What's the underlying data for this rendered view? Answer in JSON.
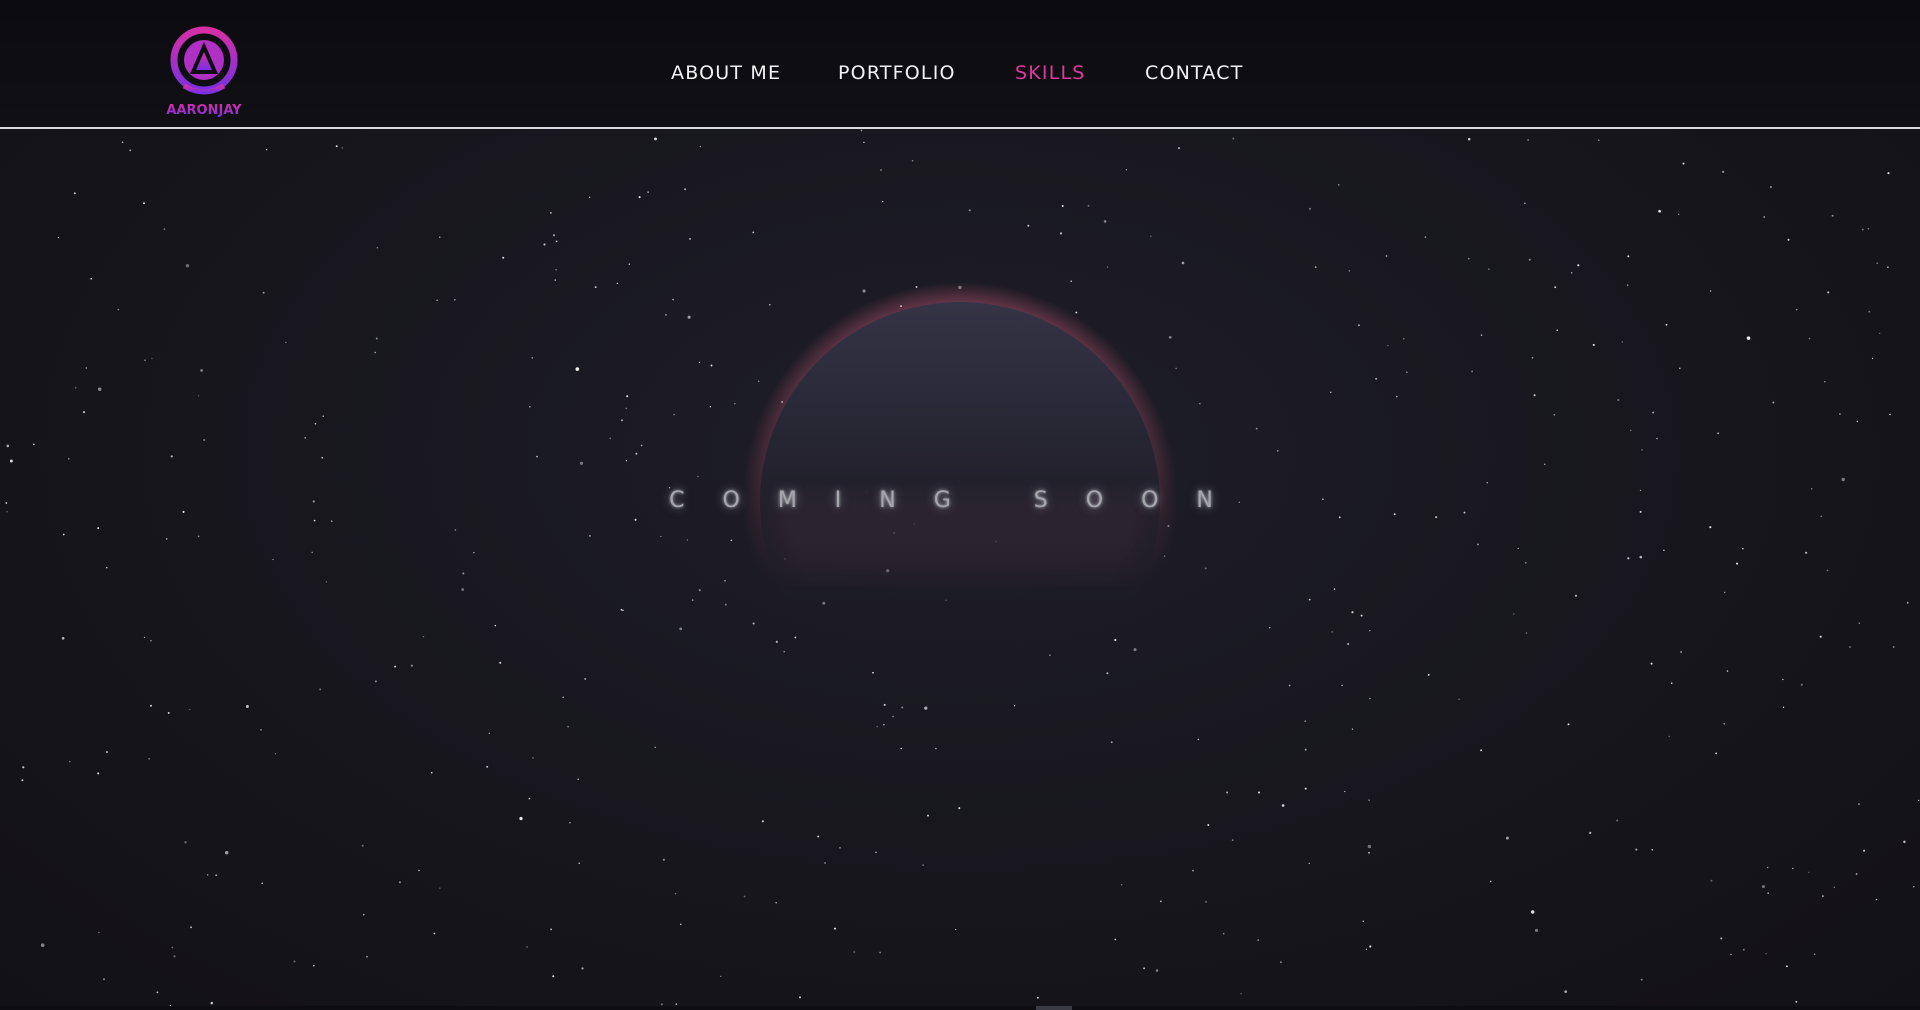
{
  "header": {
    "logo_text": "AARONJAY",
    "nav": [
      {
        "label": "ABOUT ME",
        "active": false
      },
      {
        "label": "PORTFOLIO",
        "active": false
      },
      {
        "label": "SKILLS",
        "active": true
      },
      {
        "label": "CONTACT",
        "active": false
      }
    ]
  },
  "hero": {
    "headline": "COMING SOON"
  },
  "colors": {
    "accent": "#e0369f",
    "logo_gradient_start": "#d62fa6",
    "logo_gradient_end": "#7a2fe0",
    "planet_glow": "#ff7a9c",
    "background": "#17161d"
  },
  "icons": {
    "logo": "aaronjay-logo-icon",
    "scroll": "scroll-indicator-icon"
  }
}
